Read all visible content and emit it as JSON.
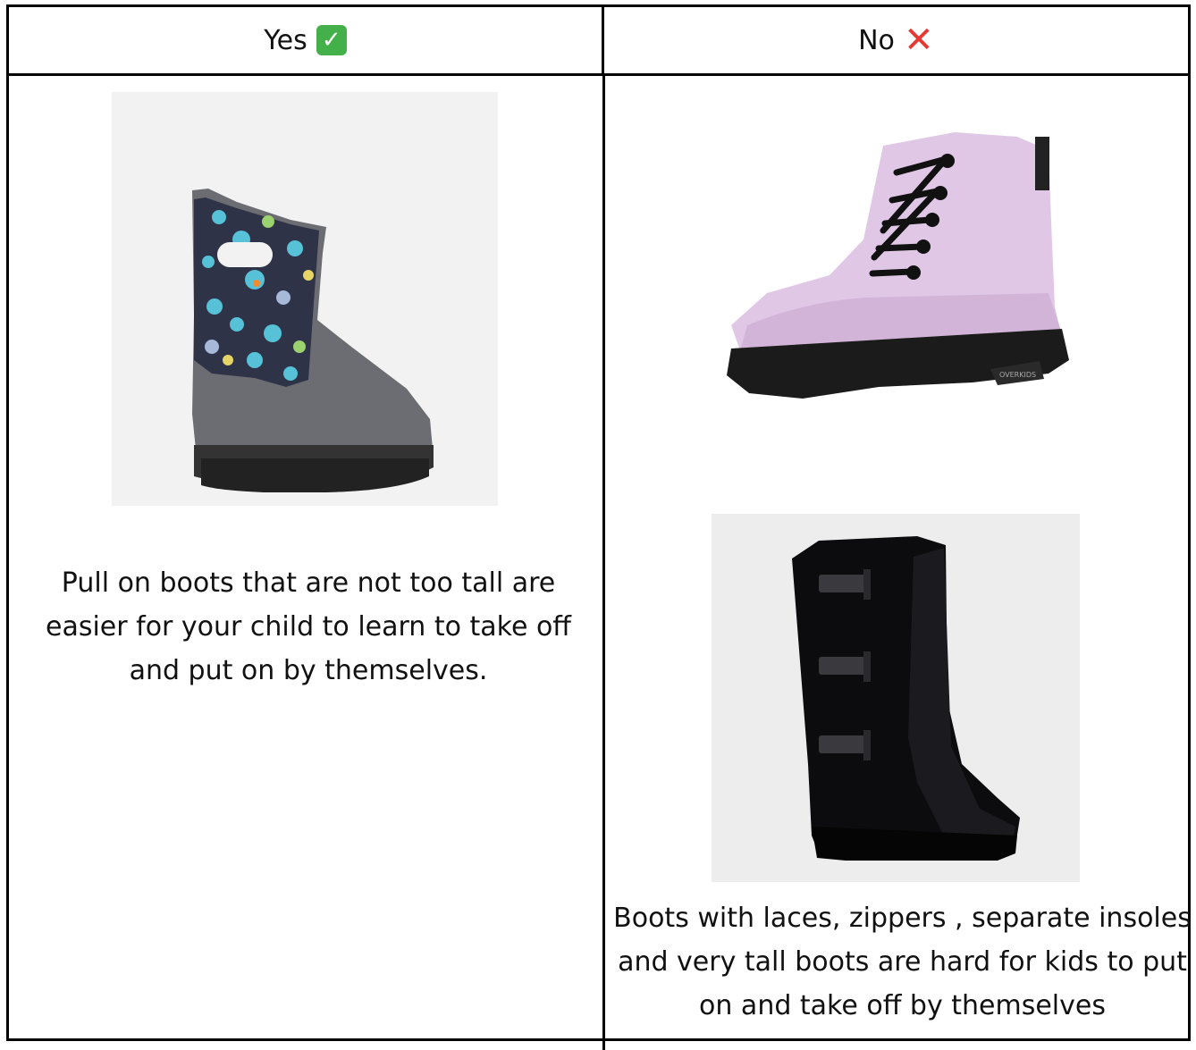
{
  "table": {
    "headers": {
      "yes": "Yes",
      "no": "No"
    },
    "icons": {
      "yes": "check-mark-button-icon",
      "no": "cross-mark-icon"
    },
    "colors": {
      "yes_badge": "#43b04a",
      "no_mark": "#e53935"
    },
    "yes_caption": "Pull on boots that are not too tall are easier for your child to learn to take off and put on by themselves.",
    "no_caption": "Boots with laces, zippers , separate insoles and very tall boots are hard for kids to put on and take off by themselves",
    "images": {
      "yes_boot": "rain-boot-image",
      "no_boot_1": "lace-up-boot-image",
      "no_boot_2": "tall-winter-boot-image"
    }
  }
}
